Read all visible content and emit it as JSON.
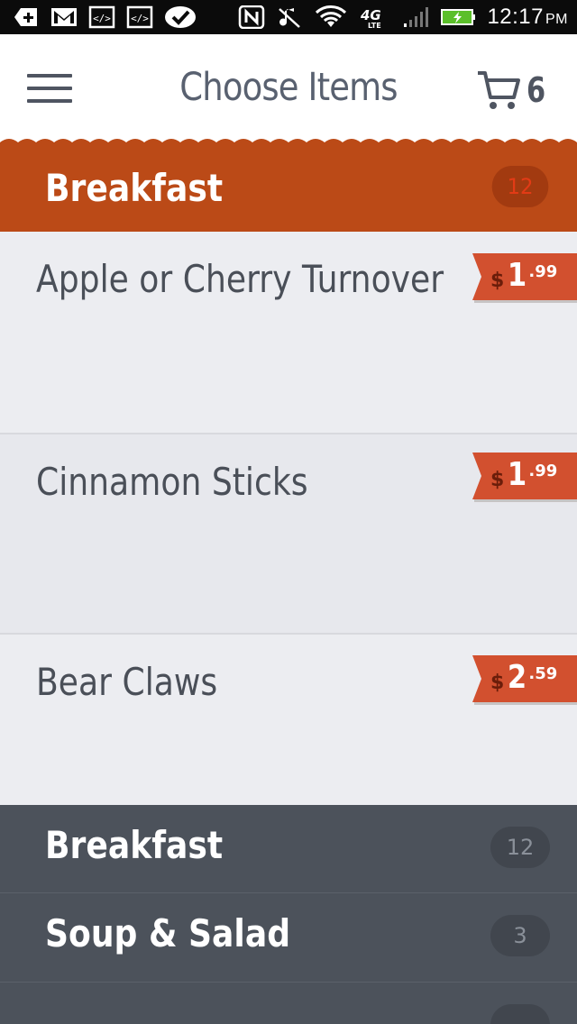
{
  "status_bar": {
    "time": "12:17",
    "ampm": "PM",
    "icons": [
      "add-icon",
      "gmail-icon",
      "code-icon",
      "code-icon",
      "check-bubble-icon",
      "nfc-icon",
      "mute-icon",
      "wifi-icon",
      "4g-lte-icon",
      "signal-icon",
      "battery-charging-icon"
    ]
  },
  "header": {
    "title": "Choose Items",
    "cart_count": "6"
  },
  "category": {
    "name": "Breakfast",
    "count": "12"
  },
  "items": [
    {
      "name": "Apple or Cherry Turnover",
      "price_dollar": "$",
      "price_main": "1",
      "price_cents": ".99"
    },
    {
      "name": "Cinnamon Sticks",
      "price_dollar": "$",
      "price_main": "1",
      "price_cents": ".99"
    },
    {
      "name": "Bear Claws",
      "price_dollar": "$",
      "price_main": "2",
      "price_cents": ".59"
    }
  ],
  "drawer": [
    {
      "name": "Breakfast",
      "count": "12"
    },
    {
      "name": "Soup & Salad",
      "count": "3"
    }
  ],
  "colors": {
    "accent": "#bb4a17",
    "price_tag": "#d2502f",
    "drawer_bg": "#4c525b"
  }
}
